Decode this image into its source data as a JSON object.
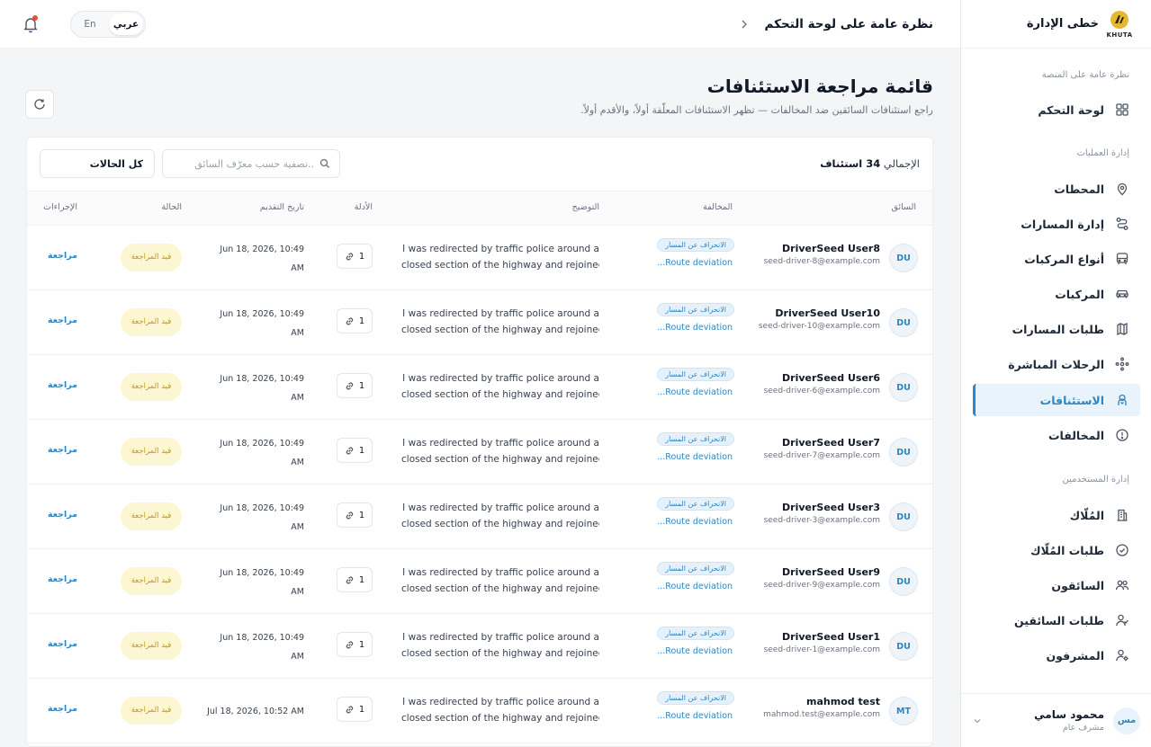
{
  "brand": {
    "name": "خطى الإدارة",
    "logo_word": "KHUTA"
  },
  "sidebar": {
    "sections": [
      {
        "label": "نظرة عامة على المنصة"
      },
      {
        "label": "إدارة العمليات"
      },
      {
        "label": "إدارة المستخدمين"
      }
    ],
    "items": [
      {
        "label": "لوحة التحكم",
        "icon": "grid-icon"
      },
      {
        "label": "المحطات",
        "icon": "map-pin-icon"
      },
      {
        "label": "إدارة المسارات",
        "icon": "route-icon"
      },
      {
        "label": "أنواع المركبات",
        "icon": "bus-icon"
      },
      {
        "label": "المركبات",
        "icon": "car-icon"
      },
      {
        "label": "طلبات المسارات",
        "icon": "map-request-icon"
      },
      {
        "label": "الرحلات المباشرة",
        "icon": "live-trips-icon"
      },
      {
        "label": "الاستئنافات",
        "icon": "appeals-icon"
      },
      {
        "label": "المخالفات",
        "icon": "alert-circle-icon"
      },
      {
        "label": "المُلّاك",
        "icon": "building-icon"
      },
      {
        "label": "طلبات المُلّاك",
        "icon": "check-circle-icon"
      },
      {
        "label": "السائقون",
        "icon": "users-icon"
      },
      {
        "label": "طلبات السائقين",
        "icon": "user-check-icon"
      },
      {
        "label": "المشرفون",
        "icon": "user-cog-icon"
      }
    ],
    "active_index": 7,
    "user": {
      "initials": "مس",
      "name": "محمود سامي",
      "role": "مشرف عام"
    }
  },
  "topbar": {
    "breadcrumb": "نظرة عامة على لوحة التحكم",
    "lang": {
      "arabic": "عربي",
      "english": "En",
      "selected": "عربي"
    }
  },
  "page": {
    "title": "قائمة مراجعة الاستئنافات",
    "subtitle": "راجع استئنافات السائقين ضد المخالفات — تظهر الاستئنافات المعلّقة أولاً، والأقدم أولاً."
  },
  "toolbar": {
    "total_label": "الإجمالي",
    "total_value": "34 استئناف",
    "filter_placeholder": "..تصفية حسب معرّف السائق",
    "status_filter": "كل الحالات"
  },
  "columns": {
    "driver": "السائق",
    "violation": "المخالفة",
    "description": "التوضيح",
    "evidence": "الأدلة",
    "submitted": "تاريخ التقديم",
    "status": "الحالة",
    "actions": "الإجراءات"
  },
  "rows": [
    {
      "initials": "DU",
      "name": "DriverSeed User8",
      "email": "seed-driver-8@example.com",
      "violation_badge": "الانحراف عن المسار",
      "violation_link": "...Route deviation",
      "desc1": "I was redirected by traffic police around a",
      "desc2": "closed section of the highway and rejoined",
      "evidence": "1",
      "date1": "Jun 18, 2026, 10:49",
      "date2": "AM",
      "status": "قيد المراجعة",
      "action": "مراجعة"
    },
    {
      "initials": "DU",
      "name": "DriverSeed User10",
      "email": "seed-driver-10@example.com",
      "violation_badge": "الانحراف عن المسار",
      "violation_link": "...Route deviation",
      "desc1": "I was redirected by traffic police around a",
      "desc2": "closed section of the highway and rejoined",
      "evidence": "1",
      "date1": "Jun 18, 2026, 10:49",
      "date2": "AM",
      "status": "قيد المراجعة",
      "action": "مراجعة"
    },
    {
      "initials": "DU",
      "name": "DriverSeed User6",
      "email": "seed-driver-6@example.com",
      "violation_badge": "الانحراف عن المسار",
      "violation_link": "...Route deviation",
      "desc1": "I was redirected by traffic police around a",
      "desc2": "closed section of the highway and rejoined",
      "evidence": "1",
      "date1": "Jun 18, 2026, 10:49",
      "date2": "AM",
      "status": "قيد المراجعة",
      "action": "مراجعة"
    },
    {
      "initials": "DU",
      "name": "DriverSeed User7",
      "email": "seed-driver-7@example.com",
      "violation_badge": "الانحراف عن المسار",
      "violation_link": "...Route deviation",
      "desc1": "I was redirected by traffic police around a",
      "desc2": "closed section of the highway and rejoined",
      "evidence": "1",
      "date1": "Jun 18, 2026, 10:49",
      "date2": "AM",
      "status": "قيد المراجعة",
      "action": "مراجعة"
    },
    {
      "initials": "DU",
      "name": "DriverSeed User3",
      "email": "seed-driver-3@example.com",
      "violation_badge": "الانحراف عن المسار",
      "violation_link": "...Route deviation",
      "desc1": "I was redirected by traffic police around a",
      "desc2": "closed section of the highway and rejoined",
      "evidence": "1",
      "date1": "Jun 18, 2026, 10:49",
      "date2": "AM",
      "status": "قيد المراجعة",
      "action": "مراجعة"
    },
    {
      "initials": "DU",
      "name": "DriverSeed User9",
      "email": "seed-driver-9@example.com",
      "violation_badge": "الانحراف عن المسار",
      "violation_link": "...Route deviation",
      "desc1": "I was redirected by traffic police around a",
      "desc2": "closed section of the highway and rejoined",
      "evidence": "1",
      "date1": "Jun 18, 2026, 10:49",
      "date2": "AM",
      "status": "قيد المراجعة",
      "action": "مراجعة"
    },
    {
      "initials": "DU",
      "name": "DriverSeed User1",
      "email": "seed-driver-1@example.com",
      "violation_badge": "الانحراف عن المسار",
      "violation_link": "...Route deviation",
      "desc1": "I was redirected by traffic police around a",
      "desc2": "closed section of the highway and rejoined",
      "evidence": "1",
      "date1": "Jun 18, 2026, 10:49",
      "date2": "AM",
      "status": "قيد المراجعة",
      "action": "مراجعة"
    },
    {
      "initials": "MT",
      "name": "mahmod test",
      "email": "mahmod.test@example.com",
      "violation_badge": "الانحراف عن المسار",
      "violation_link": "...Route deviation",
      "desc1": "I was redirected by traffic police around a",
      "desc2": "closed section of the highway and rejoined",
      "evidence": "1",
      "date1": "Jul 18, 2026, 10:52 AM",
      "date2": "",
      "status": "قيد المراجعة",
      "action": "مراجعة"
    }
  ],
  "colors": {
    "accent": "#2e86c1",
    "status_pending_bg": "#fdf6d3",
    "status_pending_text": "#c19a08",
    "notification_dot": "#e74c3c"
  }
}
